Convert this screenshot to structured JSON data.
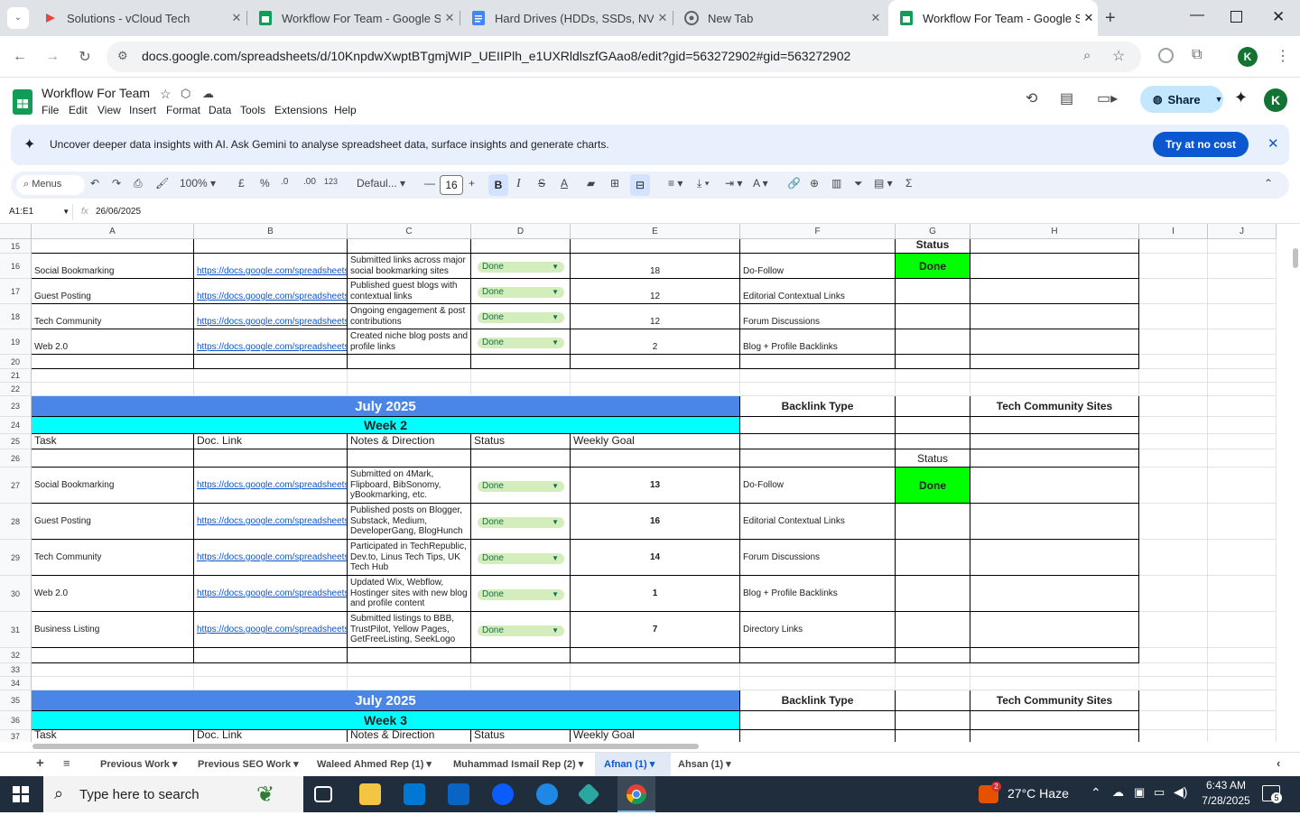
{
  "browser": {
    "tabs": [
      {
        "title": "Solutions - vCloud Tech",
        "icon": "vcloud-icon"
      },
      {
        "title": "Workflow For Team - Google Sh",
        "icon": "sheets-icon"
      },
      {
        "title": "Hard Drives (HDDs, SSDs, NVMe",
        "icon": "docs-icon"
      },
      {
        "title": "New Tab",
        "icon": "chrome-icon"
      },
      {
        "title": "Workflow For Team - Google Sh",
        "icon": "sheets-icon",
        "active": true
      }
    ],
    "url": "docs.google.com/spreadsheets/d/10KnpdwXwptBTgmjWIP_UEIIPlh_e1UXRldlszfGAao8/edit?gid=563272902#gid=563272902",
    "profile_initial": "K"
  },
  "sheets": {
    "title": "Workflow For Team",
    "menus": [
      "File",
      "Edit",
      "View",
      "Insert",
      "Format",
      "Data",
      "Tools",
      "Extensions",
      "Help"
    ],
    "share_label": "Share",
    "avatar_initial": "K",
    "banner": {
      "text_bold": "Uncover deeper data insights with AI.",
      "text": "Ask Gemini to analyse spreadsheet data, surface insights and generate charts.",
      "button": "Try at no cost"
    },
    "toolbar": {
      "menus_label": "Menus",
      "zoom": "100%",
      "currency": "£",
      "percent": "%",
      "dec_minus": ".0",
      "dec_plus": ".00",
      "number_fmt": "123",
      "font": "Defaul...",
      "font_size": "16",
      "bold": "B",
      "italic": "I",
      "strike": "S",
      "text_color": "A"
    },
    "name_box": "A1:E1",
    "formula": "26/06/2025"
  },
  "grid": {
    "columns": [
      "A",
      "B",
      "C",
      "D",
      "E",
      "F",
      "G",
      "H",
      "I",
      "J"
    ],
    "row_numbers": [
      "15",
      "16",
      "17",
      "18",
      "19",
      "20",
      "21",
      "22",
      "23",
      "24",
      "25",
      "26",
      "27",
      "28",
      "29",
      "30",
      "31",
      "32",
      "33",
      "34",
      "35",
      "36",
      "37"
    ],
    "link_text": "https://docs.google.com/spreadsheets",
    "block1": {
      "status_header": "Status",
      "status_done": "Done",
      "rows": [
        {
          "task": "Social Bookmarking",
          "notes": "Submitted links across major social bookmarking sites",
          "status": "Done",
          "goal": "18",
          "type": "Do-Follow"
        },
        {
          "task": "Guest Posting",
          "notes": "Published guest blogs with contextual links",
          "status": "Done",
          "goal": "12",
          "type": "Editorial Contextual Links"
        },
        {
          "task": "Tech Community",
          "notes": "Ongoing engagement & post contributions",
          "status": "Done",
          "goal": "12",
          "type": "Forum Discussions"
        },
        {
          "task": "Web 2.0",
          "notes": "Created niche blog posts and profile links",
          "status": "Done",
          "goal": "2",
          "type": "Blog + Profile Backlinks"
        }
      ]
    },
    "block2": {
      "month": "July 2025",
      "backlink_type": "Backlink Type",
      "community_sites": "Tech Community Sites",
      "week": "Week 2",
      "headers": [
        "Task",
        "Doc. Link",
        "Notes & Direction",
        "Status",
        "Weekly Goal"
      ],
      "status_header": "Status",
      "status_done": "Done",
      "rows": [
        {
          "task": "Social Bookmarking",
          "notes": "Submitted on 4Mark, Flipboard, BibSonomy, yBookmarking, etc.",
          "status": "Done",
          "goal": "13",
          "type": "Do-Follow"
        },
        {
          "task": "Guest Posting",
          "notes": "Published posts on Blogger, Substack, Medium, DeveloperGang, BlogHunch",
          "status": "Done",
          "goal": "16",
          "type": "Editorial Contextual Links"
        },
        {
          "task": "Tech Community",
          "notes": "Participated in TechRepublic, Dev.to, Linus Tech Tips, UK Tech Hub",
          "status": "Done",
          "goal": "14",
          "type": "Forum Discussions"
        },
        {
          "task": "Web 2.0",
          "notes": "Updated Wix, Webflow, Hostinger sites with new blog and profile content",
          "status": "Done",
          "goal": "1",
          "type": "Blog + Profile Backlinks"
        },
        {
          "task": "Business Listing",
          "notes": "Submitted listings to BBB, TrustPilot, Yellow Pages, GetFreeListing, SeekLogo",
          "status": "Done",
          "goal": "7",
          "type": "Directory Links"
        }
      ]
    },
    "block3": {
      "month": "July 2025",
      "backlink_type": "Backlink Type",
      "community_sites": "Tech Community Sites",
      "week": "Week 3",
      "headers": [
        "Task",
        "Doc. Link",
        "Notes & Direction",
        "Status",
        "Weekly Goal"
      ]
    }
  },
  "sheet_tabs": [
    "Previous Work",
    "Previous SEO Work",
    "Waleed Ahmed Rep (1)",
    "Muhammad Ismail Rep (2)",
    "Afnan (1)",
    "Ahsan (1)"
  ],
  "active_sheet": "Afnan (1)",
  "taskbar": {
    "search_placeholder": "Type here to search",
    "weather": "27°C  Haze",
    "weather_badge": "2",
    "time": "6:43 AM",
    "date": "7/28/2025",
    "notifications": "5"
  },
  "colors": {
    "header_blue": "#4a86e8",
    "week_cyan": "#00ffff",
    "done_green": "#00ff00",
    "chip_green": "#d4edbc",
    "link_blue": "#1155cc"
  }
}
